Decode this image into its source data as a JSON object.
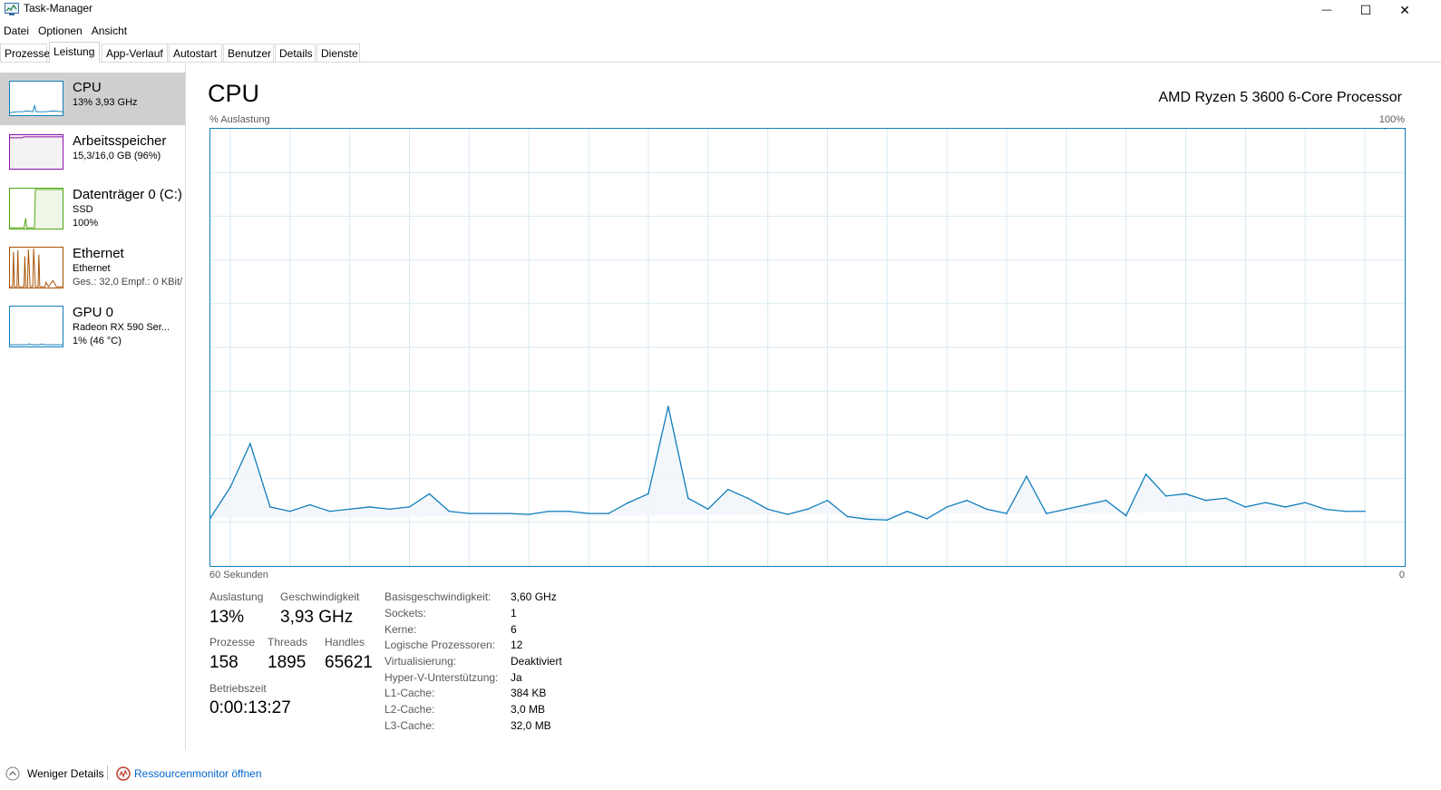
{
  "window": {
    "title": "Task-Manager",
    "minimize_glyph": "—",
    "maximize_glyph": "☐",
    "close_glyph": "✕"
  },
  "menu": [
    "Datei",
    "Optionen",
    "Ansicht"
  ],
  "tabs": [
    {
      "label": "Prozesse",
      "active": false
    },
    {
      "label": "Leistung",
      "active": true
    },
    {
      "label": "App-Verlauf",
      "active": false
    },
    {
      "label": "Autostart",
      "active": false
    },
    {
      "label": "Benutzer",
      "active": false
    },
    {
      "label": "Details",
      "active": false
    },
    {
      "label": "Dienste",
      "active": false
    }
  ],
  "sidebar": {
    "items": [
      {
        "title": "CPU",
        "sub1": "13% 3,93 GHz",
        "sub2": "",
        "color": "#117dbb",
        "selected": true
      },
      {
        "title": "Arbeitsspeicher",
        "sub1": "15,3/16,0 GB (96%)",
        "sub2": "",
        "color": "#8b12ae",
        "selected": false
      },
      {
        "title": "Datenträger 0 (C:)",
        "sub1": "SSD",
        "sub2": "100%",
        "color": "#4da60c",
        "selected": false
      },
      {
        "title": "Ethernet",
        "sub1": "Ethernet",
        "sub2": "Ges.: 32,0  Empf.: 0 KBit/",
        "color": "#a74f01",
        "selected": false
      },
      {
        "title": "GPU 0",
        "sub1": "Radeon RX 590 Ser...",
        "sub2": "1% (46 °C)",
        "color": "#117dbb",
        "selected": false
      }
    ]
  },
  "main": {
    "title": "CPU",
    "processor": "AMD Ryzen 5 3600 6-Core Processor",
    "y_label": "% Auslastung",
    "y_max_label": "100%",
    "x_left_label": "60 Sekunden",
    "x_right_label": "0"
  },
  "chart_data": {
    "type": "area",
    "ylim": [
      0,
      100
    ],
    "x_unit": "seconds ago",
    "grid": true,
    "line_color": "#117dbb",
    "fill_color": "#f1f6fa",
    "x": [
      60,
      59,
      58,
      57,
      56,
      55,
      54,
      53,
      52,
      51,
      50,
      49,
      48,
      47,
      46,
      45,
      44,
      43,
      42,
      41,
      40,
      39,
      38,
      37,
      36,
      35,
      34,
      33,
      32,
      31,
      30,
      29,
      28,
      27,
      26,
      25,
      24,
      23,
      22,
      21,
      20,
      19,
      18,
      17,
      16,
      15,
      14,
      13,
      12,
      11,
      10,
      9,
      8,
      7,
      6,
      5,
      4,
      3,
      2,
      1,
      0
    ],
    "values": [
      11,
      18,
      28,
      13.5,
      12.5,
      14,
      12.5,
      13,
      13.5,
      13,
      13.5,
      16.5,
      12.5,
      12,
      12,
      12,
      11.8,
      12.5,
      12.5,
      12,
      12,
      14.5,
      16.5,
      36.5,
      15.5,
      13,
      17.5,
      15.5,
      13,
      11.8,
      13,
      15,
      11.3,
      10.7,
      10.5,
      12.5,
      10.8,
      13.5,
      15,
      13,
      12,
      20.5,
      12,
      13,
      14,
      15,
      11.5,
      21,
      16,
      16.5,
      15,
      15.5,
      13.5,
      14.5,
      13.5,
      14.5,
      13,
      12.5,
      12.5
    ]
  },
  "stats": {
    "auslastung_label": "Auslastung",
    "auslastung_value": "13%",
    "geschwindigkeit_label": "Geschwindigkeit",
    "geschwindigkeit_value": "3,93 GHz",
    "prozesse_label": "Prozesse",
    "prozesse_value": "158",
    "threads_label": "Threads",
    "threads_value": "1895",
    "handles_label": "Handles",
    "handles_value": "65621",
    "betriebszeit_label": "Betriebszeit",
    "betriebszeit_value": "0:00:13:27"
  },
  "info": [
    {
      "label": "Basisgeschwindigkeit:",
      "value": "3,60 GHz"
    },
    {
      "label": "Sockets:",
      "value": "1"
    },
    {
      "label": "Kerne:",
      "value": "6"
    },
    {
      "label": "Logische Prozessoren:",
      "value": "12"
    },
    {
      "label": "Virtualisierung:",
      "value": "Deaktiviert"
    },
    {
      "label": "Hyper-V-Unterstützung:",
      "value": "Ja"
    },
    {
      "label": "L1-Cache:",
      "value": "384 KB"
    },
    {
      "label": "L2-Cache:",
      "value": "3,0 MB"
    },
    {
      "label": "L3-Cache:",
      "value": "32,0 MB"
    }
  ],
  "footer": {
    "less_details": "Weniger Details",
    "resource_monitor": "Ressourcenmonitor öffnen"
  }
}
